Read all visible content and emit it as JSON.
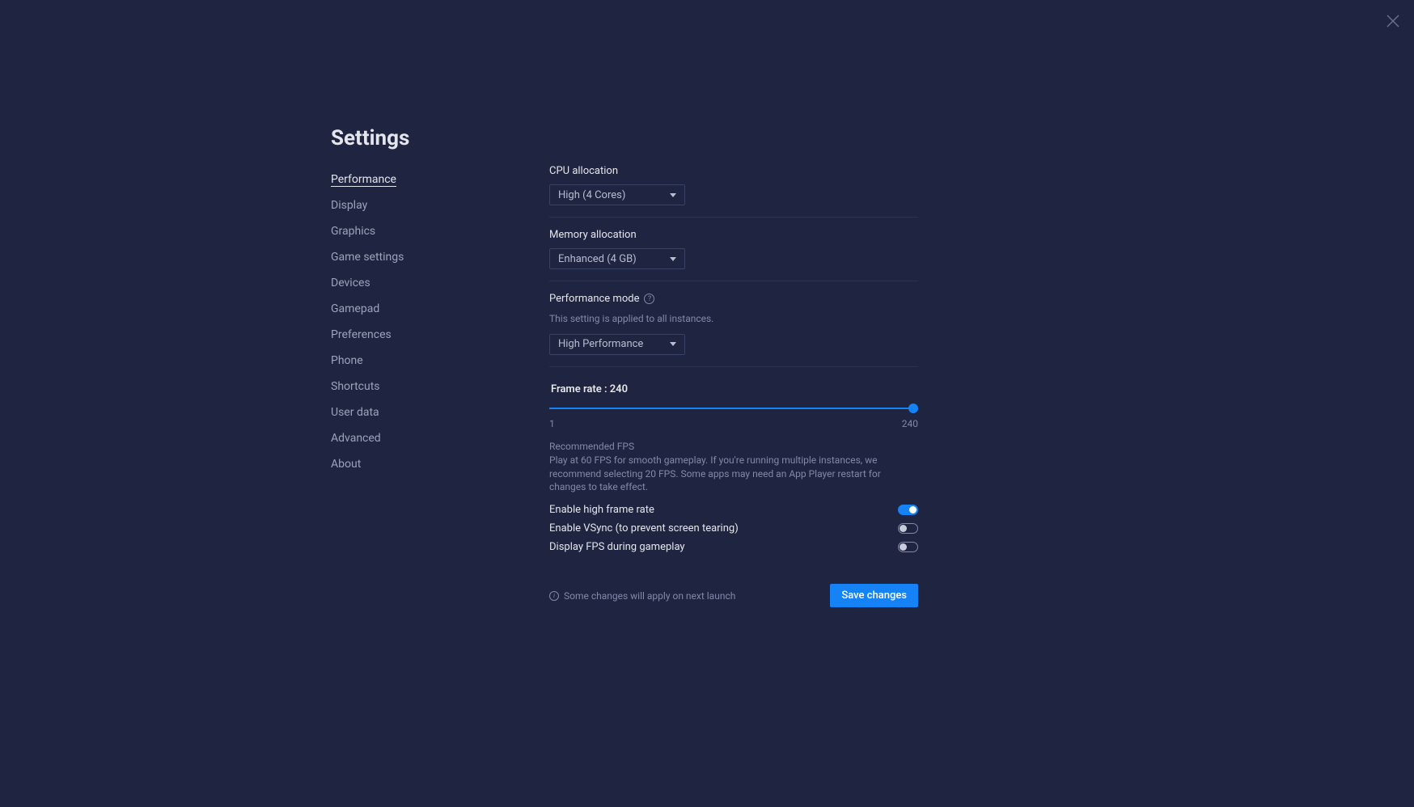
{
  "title": "Settings",
  "sidebar": {
    "items": [
      {
        "label": "Performance",
        "active": true
      },
      {
        "label": "Display",
        "active": false
      },
      {
        "label": "Graphics",
        "active": false
      },
      {
        "label": "Game settings",
        "active": false
      },
      {
        "label": "Devices",
        "active": false
      },
      {
        "label": "Gamepad",
        "active": false
      },
      {
        "label": "Preferences",
        "active": false
      },
      {
        "label": "Phone",
        "active": false
      },
      {
        "label": "Shortcuts",
        "active": false
      },
      {
        "label": "User data",
        "active": false
      },
      {
        "label": "Advanced",
        "active": false
      },
      {
        "label": "About",
        "active": false
      }
    ]
  },
  "cpu": {
    "label": "CPU allocation",
    "value": "High (4 Cores)"
  },
  "memory": {
    "label": "Memory allocation",
    "value": "Enhanced (4 GB)"
  },
  "perf_mode": {
    "label": "Performance mode",
    "subtext": "This setting is applied to all instances.",
    "value": "High Performance"
  },
  "frame_rate": {
    "label": "Frame rate : 240",
    "min": "1",
    "max": "240",
    "rec_title": "Recommended FPS",
    "rec_text": "Play at 60 FPS for smooth gameplay. If you're running multiple instances, we recommend selecting 20 FPS. Some apps may need an App Player restart for changes to take effect."
  },
  "toggles": {
    "high_frame_rate": "Enable high frame rate",
    "vsync": "Enable VSync (to prevent screen tearing)",
    "display_fps": "Display FPS during gameplay"
  },
  "footer": {
    "note": "Some changes will apply on next launch",
    "save": "Save changes"
  }
}
